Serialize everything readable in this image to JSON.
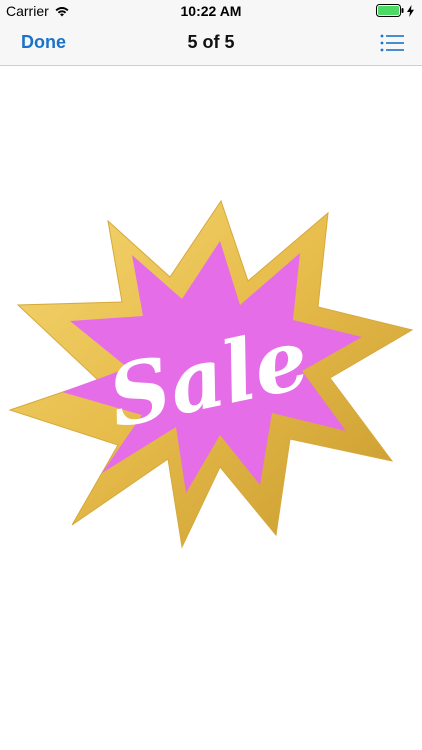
{
  "status_bar": {
    "carrier": "Carrier",
    "time": "10:22 AM",
    "wifi_icon": "wifi-icon",
    "battery_icon": "battery-icon",
    "charging_icon": "charging-bolt-icon",
    "battery_level": 1.0
  },
  "nav": {
    "done_label": "Done",
    "title": "5 of 5",
    "list_icon": "list-icon"
  },
  "sticker": {
    "text": "Sale",
    "colors": {
      "gold": "#e9c04f",
      "gold_dark": "#c99a2a",
      "pink": "#e66de8",
      "text": "#ffffff",
      "accent": "#1a73c9",
      "battery": "#4cd964"
    }
  }
}
